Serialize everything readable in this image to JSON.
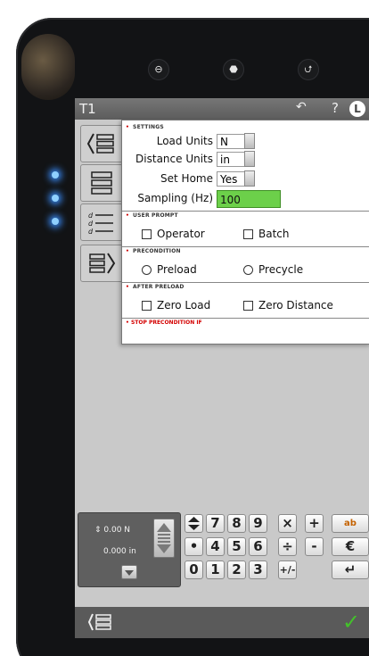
{
  "device": {
    "hw_buttons": [
      "⊖",
      "⬣",
      "⮍"
    ]
  },
  "titlebar": {
    "title": "T1",
    "back_icon": "back-arrow-icon",
    "help": "?",
    "user": "L"
  },
  "settings": {
    "header": "SETTINGS",
    "load_units_label": "Load Units",
    "load_units_value": "N",
    "distance_units_label": "Distance Units",
    "distance_units_value": "in",
    "set_home_label": "Set Home",
    "set_home_value": "Yes",
    "sampling_label": "Sampling (Hz)",
    "sampling_value": "100"
  },
  "user_prompt": {
    "header": "USER PROMPT",
    "operator": "Operator",
    "batch": "Batch"
  },
  "precondition": {
    "header": "PRECONDITION",
    "preload": "Preload",
    "precycle": "Precycle"
  },
  "after_preload": {
    "header": "AFTER PRELOAD",
    "zero_load": "Zero Load",
    "zero_distance": "Zero Distance"
  },
  "stop_precondition": {
    "header": "STOP PRECONDITION IF"
  },
  "readout": {
    "load": "0.00 N",
    "distance": "0.000 in"
  },
  "keypad": {
    "row1": [
      "7",
      "8",
      "9",
      "×",
      "+",
      "ab"
    ],
    "row2": [
      "•",
      "4",
      "5",
      "6",
      "÷",
      "-",
      "€"
    ],
    "row3": [
      "0",
      "1",
      "2",
      "3",
      "+/-",
      "↵"
    ]
  },
  "colors": {
    "accent_green": "#6cd04a",
    "confirm_check": "#43c12b",
    "titlebar": "#6a6a6a"
  }
}
